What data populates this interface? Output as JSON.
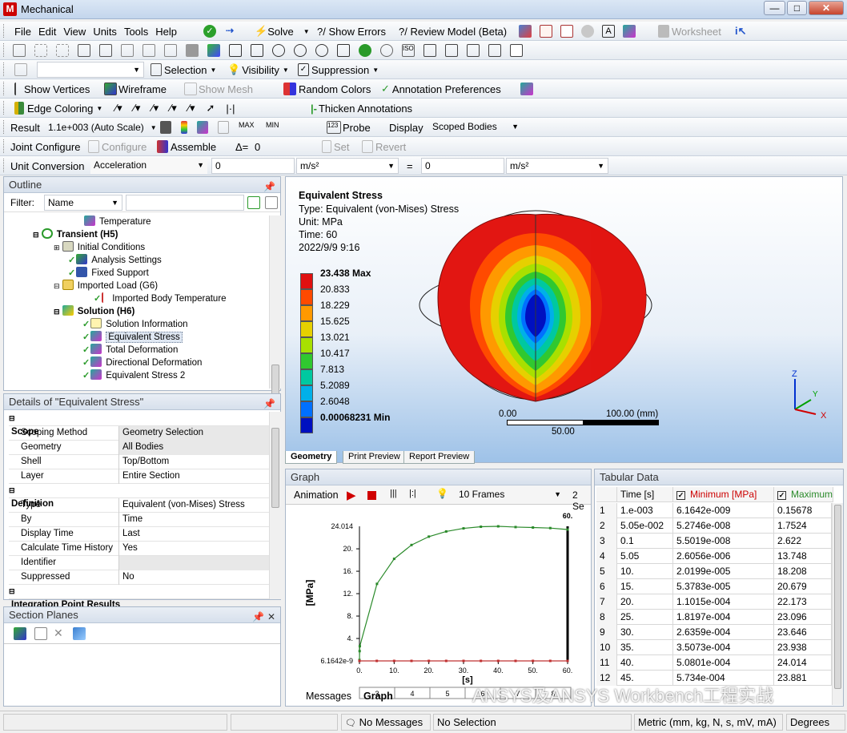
{
  "window": {
    "title": "Mechanical",
    "app_letter": "M",
    "min": "—",
    "max": "□",
    "close": "✕"
  },
  "menubar": {
    "items": [
      "File",
      "Edit",
      "View",
      "Units",
      "Tools",
      "Help"
    ],
    "solve": "Solve",
    "show_errors": "?/ Show Errors",
    "review_model": "?/ Review Model (Beta)",
    "worksheet": "Worksheet"
  },
  "toolbar3": {
    "selection": "Selection",
    "visibility": "Visibility",
    "suppression": "Suppression"
  },
  "toolbar4": {
    "show_vertices": "Show Vertices",
    "wireframe": "Wireframe",
    "show_mesh": "Show Mesh",
    "random_colors": "Random Colors",
    "annotation_prefs": "Annotation Preferences"
  },
  "toolbar5": {
    "edge_coloring": "Edge Coloring",
    "thicken": "Thicken Annotations"
  },
  "toolbar6": {
    "result_label": "Result",
    "scale": "1.1e+003 (Auto Scale)",
    "probe": "Probe",
    "display_label": "Display",
    "display_value": "Scoped Bodies"
  },
  "toolbar7": {
    "joint_configure": "Joint Configure",
    "configure": "Configure",
    "assemble": "Assemble",
    "delta": "Δ=",
    "delta_value": "0",
    "set": "Set",
    "revert": "Revert"
  },
  "toolbar8": {
    "label": "Unit Conversion",
    "quantity": "Acceleration",
    "value_a": "0",
    "unit_a": "m/s²",
    "equals": "=",
    "value_b": "0",
    "unit_b": "m/s²"
  },
  "outline": {
    "title": "Outline",
    "filter_label": "Filter:",
    "filter_value": "Name",
    "items": [
      {
        "label": "Temperature",
        "bold": false
      },
      {
        "label": "Transient (H5)",
        "bold": true
      },
      {
        "label": "Initial Conditions",
        "bold": false
      },
      {
        "label": "Analysis Settings",
        "bold": false
      },
      {
        "label": "Fixed Support",
        "bold": false
      },
      {
        "label": "Imported Load (G6)",
        "bold": false
      },
      {
        "label": "Imported Body Temperature",
        "bold": false
      },
      {
        "label": "Solution (H6)",
        "bold": true
      },
      {
        "label": "Solution Information",
        "bold": false
      },
      {
        "label": "Equivalent Stress",
        "bold": false
      },
      {
        "label": "Total Deformation",
        "bold": false
      },
      {
        "label": "Directional Deformation",
        "bold": false
      },
      {
        "label": "Equivalent Stress 2",
        "bold": false
      }
    ]
  },
  "details": {
    "title": "Details of \"Equivalent Stress\"",
    "rows": [
      {
        "k": "Scope",
        "v": "",
        "header": true
      },
      {
        "k": "Scoping Method",
        "v": "Geometry Selection",
        "grey": true
      },
      {
        "k": "Geometry",
        "v": "All Bodies",
        "grey": true
      },
      {
        "k": "Shell",
        "v": "Top/Bottom"
      },
      {
        "k": "Layer",
        "v": "Entire Section"
      },
      {
        "k": "Definition",
        "v": "",
        "header": true
      },
      {
        "k": "Type",
        "v": "Equivalent (von-Mises) Stress"
      },
      {
        "k": "By",
        "v": "Time"
      },
      {
        "k": "Display Time",
        "v": "Last"
      },
      {
        "k": "Calculate Time History",
        "v": "Yes"
      },
      {
        "k": "Identifier",
        "v": "",
        "grey": true
      },
      {
        "k": "Suppressed",
        "v": "No"
      },
      {
        "k": "Integration Point Results",
        "v": "",
        "header": true
      }
    ]
  },
  "section_planes": {
    "title": "Section Planes"
  },
  "viewport": {
    "title": "Equivalent Stress",
    "type": "Type: Equivalent (von-Mises) Stress",
    "unit": "Unit: MPa",
    "time": "Time: 60",
    "date": "2022/9/9 9:16",
    "legend": [
      {
        "value": "23.438 Max",
        "color": "#e01010",
        "bold": true
      },
      {
        "value": "20.833",
        "color": "#ff4a00"
      },
      {
        "value": "18.229",
        "color": "#ff9900"
      },
      {
        "value": "15.625",
        "color": "#e6d000"
      },
      {
        "value": "13.021",
        "color": "#a8e000"
      },
      {
        "value": "10.417",
        "color": "#30c830"
      },
      {
        "value": "7.813",
        "color": "#00c8a0"
      },
      {
        "value": "5.2089",
        "color": "#00b0e8"
      },
      {
        "value": "2.6048",
        "color": "#0070ff"
      },
      {
        "value": "0.00068231 Min",
        "color": "#0010c0",
        "bold": true
      }
    ],
    "scale_left": "0.00",
    "scale_right": "100.00 (mm)",
    "scale_mid": "50.00",
    "tabs": [
      "Geometry",
      "Print Preview",
      "Report Preview"
    ]
  },
  "graph": {
    "title": "Graph",
    "animation": "Animation",
    "frames": "10 Frames",
    "speed": "2 Se",
    "ylabel": "[MPa]",
    "xlabel": "[s]",
    "y_max_label": "24.014",
    "y_min_label": "6.1642e-9",
    "y_ticks": [
      "20.",
      "16.",
      "12.",
      "8.",
      "4."
    ],
    "x_ticks": [
      "0.",
      "10.",
      "20.",
      "30.",
      "40.",
      "50.",
      "60."
    ],
    "end_label": "60.",
    "frame_cells": [
      "3",
      "4",
      "5",
      "6",
      "7",
      "8"
    ],
    "tabs": [
      "Messages",
      "Graph"
    ]
  },
  "chart_data": {
    "type": "line",
    "xlabel": "[s]",
    "ylabel": "[MPa]",
    "xlim": [
      0,
      60
    ],
    "ylim": [
      0,
      24.014
    ],
    "series": [
      {
        "name": "Maximum [MPa]",
        "color": "#2a8a2a",
        "x": [
          0.001,
          0.0505,
          0.1,
          5.05,
          10,
          15,
          20,
          25,
          30,
          35,
          40,
          45,
          50,
          55,
          60
        ],
        "y": [
          0.15678,
          1.7524,
          2.622,
          13.748,
          18.208,
          20.679,
          22.173,
          23.096,
          23.646,
          23.938,
          24.014,
          23.881,
          23.8,
          23.7,
          23.438
        ]
      },
      {
        "name": "Minimum [MPa]",
        "color": "#c03030",
        "x": [
          0,
          5,
          10,
          15,
          20,
          25,
          30,
          35,
          40,
          45,
          50,
          55,
          60
        ],
        "y": [
          0,
          0,
          0,
          0,
          0,
          0,
          0,
          0,
          0,
          0,
          0,
          0,
          0
        ]
      }
    ]
  },
  "tabular": {
    "title": "Tabular Data",
    "headers": [
      "Time [s]",
      "Minimum [MPa]",
      "Maximum"
    ],
    "rows": [
      [
        "1",
        "1.e-003",
        "6.1642e-009",
        "0.15678"
      ],
      [
        "2",
        "5.05e-002",
        "5.2746e-008",
        "1.7524"
      ],
      [
        "3",
        "0.1",
        "5.5019e-008",
        "2.622"
      ],
      [
        "4",
        "5.05",
        "2.6056e-006",
        "13.748"
      ],
      [
        "5",
        "10.",
        "2.0199e-005",
        "18.208"
      ],
      [
        "6",
        "15.",
        "5.3783e-005",
        "20.679"
      ],
      [
        "7",
        "20.",
        "1.1015e-004",
        "22.173"
      ],
      [
        "8",
        "25.",
        "1.8197e-004",
        "23.096"
      ],
      [
        "9",
        "30.",
        "2.6359e-004",
        "23.646"
      ],
      [
        "10",
        "35.",
        "3.5073e-004",
        "23.938"
      ],
      [
        "11",
        "40.",
        "5.0801e-004",
        "24.014"
      ],
      [
        "12",
        "45.",
        "5.734e-004",
        "23.881"
      ]
    ]
  },
  "status": {
    "messages": "No Messages",
    "selection": "No Selection",
    "units": "Metric (mm, kg, N, s, mV, mA)",
    "degrees": "Degrees"
  },
  "watermark": "ANSYS及ANSYS Workbench工程实战"
}
